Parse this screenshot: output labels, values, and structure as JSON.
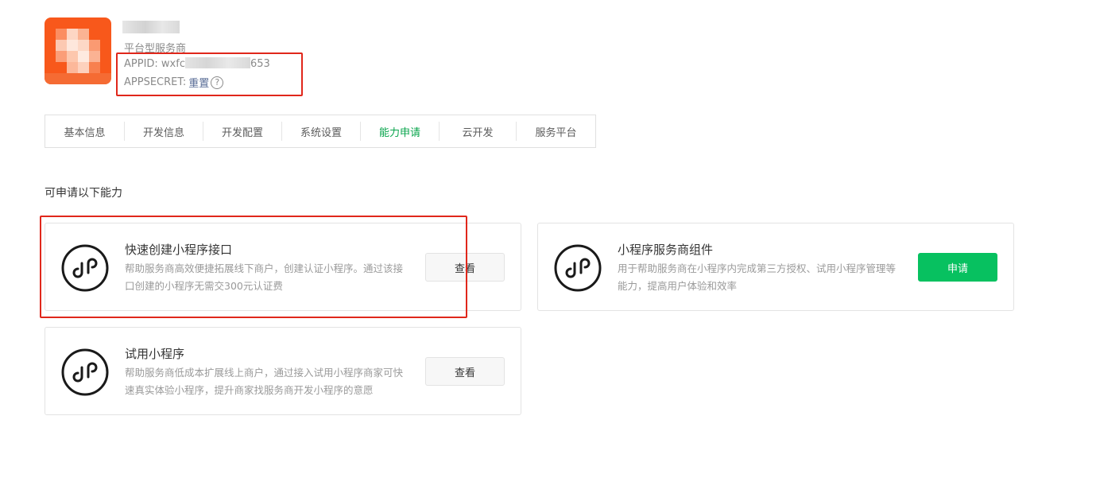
{
  "account": {
    "type_label": "平台型服务商",
    "appid_label": "APPID: wxfc",
    "appid_suffix": "653",
    "appsecret_label": "APPSECRET:",
    "reset_label": "重置",
    "help_glyph": "?",
    "avatar_color": "#f85a1e"
  },
  "tabs": [
    {
      "label": "基本信息",
      "active": false
    },
    {
      "label": "开发信息",
      "active": false
    },
    {
      "label": "开发配置",
      "active": false
    },
    {
      "label": "系统设置",
      "active": false
    },
    {
      "label": "能力申请",
      "active": true
    },
    {
      "label": "云开发",
      "active": false
    },
    {
      "label": "服务平台",
      "active": false
    }
  ],
  "section_title": "可申请以下能力",
  "cards": [
    {
      "title": "快速创建小程序接口",
      "desc": "帮助服务商高效便捷拓展线下商户，创建认证小程序。通过该接口创建的小程序无需交300元认证费",
      "button": "查看",
      "icon": "miniprogram-icon"
    },
    {
      "title": "小程序服务商组件",
      "desc": "用于帮助服务商在小程序内完成第三方授权、试用小程序管理等能力，提高用户体验和效率",
      "button": "申请",
      "icon": "miniprogram-icon"
    },
    {
      "title": "试用小程序",
      "desc": "帮助服务商低成本扩展线上商户，通过接入试用小程序商家可快速真实体验小程序，提升商家找服务商开发小程序的意愿",
      "button": "查看",
      "icon": "miniprogram-icon"
    }
  ],
  "colors": {
    "accent_green": "#07c160",
    "active_tab": "#07a44b",
    "highlight_red": "#e0271b",
    "link_blue": "#576b95"
  }
}
